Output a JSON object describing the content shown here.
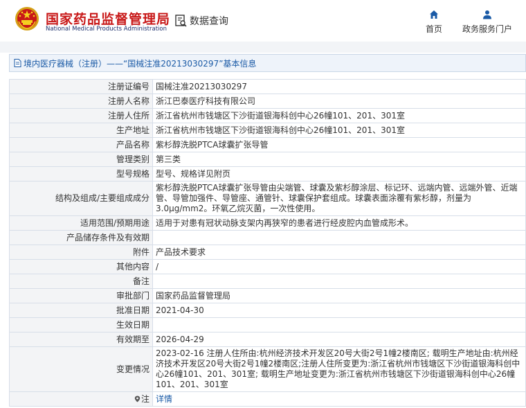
{
  "header": {
    "logo_cn": "国家药品监督管理局",
    "logo_en": "National Medical Products Administration",
    "query_label": "数据查询",
    "nav": [
      {
        "label": "首页",
        "icon": "home-icon"
      },
      {
        "label": "政务服务门户",
        "icon": "user-icon"
      }
    ]
  },
  "breadcrumb": {
    "text": "境内医疗器械（注册）——“国械注准20213030297”基本信息",
    "icon": "document-icon"
  },
  "detail_rows": [
    {
      "label": "注册证编号",
      "value": "国械注准20213030297"
    },
    {
      "label": "注册人名称",
      "value": "浙江巴泰医疗科技有限公司"
    },
    {
      "label": "注册人住所",
      "value": "浙江省杭州市钱塘区下沙街道银海科创中心26幢101、201、301室"
    },
    {
      "label": "生产地址",
      "value": "浙江省杭州市钱塘区下沙街道银海科创中心26幢101、201、301室"
    },
    {
      "label": "产品名称",
      "value": "紫杉醇洗脱PTCA球囊扩张导管"
    },
    {
      "label": "管理类别",
      "value": "第三类"
    },
    {
      "label": "型号规格",
      "value": "型号、规格详见附页"
    },
    {
      "label": "结构及组成/主要组成成分",
      "value": "紫杉醇洗脱PTCA球囊扩张导管由尖端管、球囊及紫杉醇涂层、标记环、远端内管、远端外管、近端管、导管加强件、导管座、通管针、球囊保护套组成。球囊表面涂覆有紫杉醇，剂量为3.0μg/mm2。环氧乙烷灭菌，一次性使用。"
    },
    {
      "label": "适用范围/预期用途",
      "value": "适用于对患有冠状动脉支架内再狭窄的患者进行经皮腔内血管成形术。"
    },
    {
      "label": "产品储存条件及有效期",
      "value": ""
    },
    {
      "label": "附件",
      "value": "产品技术要求"
    },
    {
      "label": "其他内容",
      "value": "/"
    },
    {
      "label": "备注",
      "value": ""
    },
    {
      "label": "审批部门",
      "value": "国家药品监督管理局"
    },
    {
      "label": "批准日期",
      "value": "2021-04-30"
    },
    {
      "label": "生效日期",
      "value": ""
    },
    {
      "label": "有效期至",
      "value": "2026-04-29"
    },
    {
      "label": "变更情况",
      "value": "2023-02-16 注册人住所由:杭州经济技术开发区20号大街2号1幢2楼南区; 载明生产地址由:杭州经济技术开发区20号大街2号1幢2楼南区;注册人住所变更为:浙江省杭州市钱塘区下沙街道银海科创中心26幢101、201、301室; 载明生产地址变更为:浙江省杭州市钱塘区下沙街道银海科创中心26幢101、201、301室"
    },
    {
      "label": "注",
      "value": "详情",
      "label_icon": "pin-icon"
    }
  ],
  "colors": {
    "brand_red": "#c81818",
    "link_blue": "#1a5aa6",
    "label_bg": "#f3f4f6",
    "border": "#d7dee8"
  }
}
